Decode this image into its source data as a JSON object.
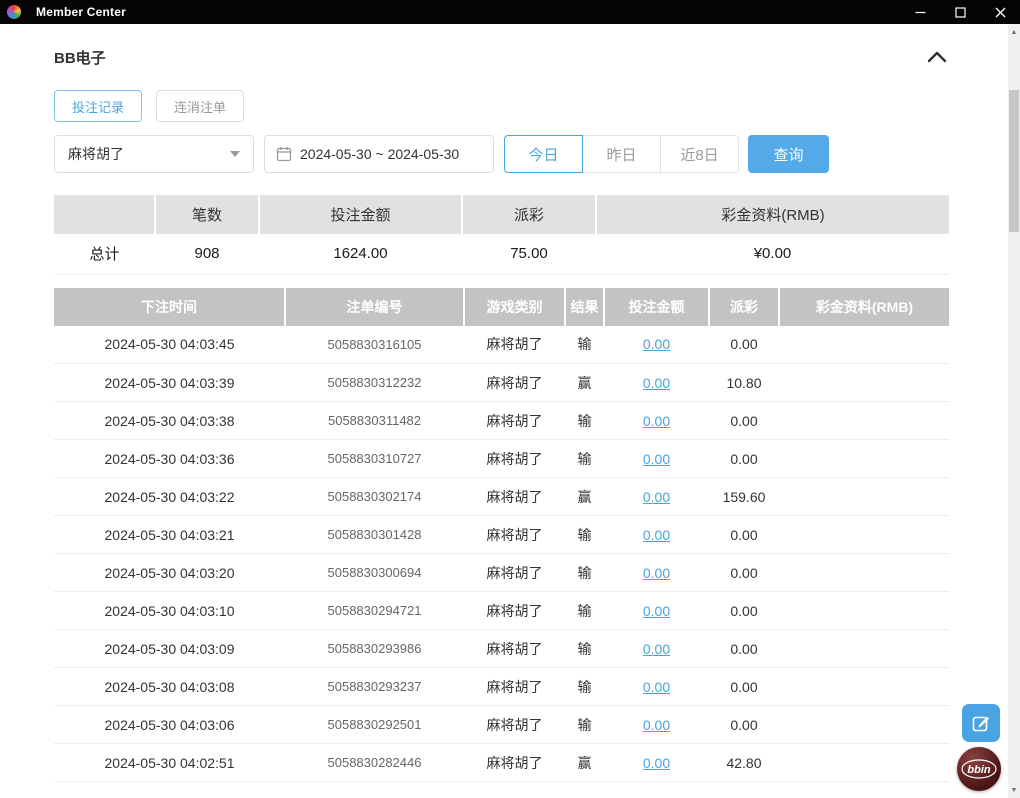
{
  "window": {
    "title": "Member Center"
  },
  "section": {
    "title": "BB电子"
  },
  "tabs": [
    {
      "label": "投注记录",
      "active": true
    },
    {
      "label": "连消注单",
      "active": false
    }
  ],
  "filters": {
    "game_select": {
      "value": "麻将胡了"
    },
    "date_range": {
      "value": "2024-05-30 ~ 2024-05-30"
    },
    "quick": [
      {
        "label": "今日",
        "active": true
      },
      {
        "label": "昨日",
        "active": false
      },
      {
        "label": "近8日",
        "active": false
      }
    ],
    "search_label": "查询"
  },
  "summary": {
    "headers": [
      "",
      "笔数",
      "投注金额",
      "派彩",
      "彩金资料(RMB)"
    ],
    "row": {
      "label": "总计",
      "count": "908",
      "bet_amount": "1624.00",
      "payout": "75.00",
      "bonus": "¥0.00"
    }
  },
  "table": {
    "headers": [
      "下注时间",
      "注单编号",
      "游戏类别",
      "结果",
      "投注金额",
      "派彩",
      "彩金资料(RMB)"
    ],
    "rows": [
      [
        "2024-05-30 04:03:45",
        "5058830316105",
        "麻将胡了",
        "输",
        "0.00",
        "0.00",
        ""
      ],
      [
        "2024-05-30 04:03:39",
        "5058830312232",
        "麻将胡了",
        "赢",
        "0.00",
        "10.80",
        ""
      ],
      [
        "2024-05-30 04:03:38",
        "5058830311482",
        "麻将胡了",
        "输",
        "0.00",
        "0.00",
        ""
      ],
      [
        "2024-05-30 04:03:36",
        "5058830310727",
        "麻将胡了",
        "输",
        "0.00",
        "0.00",
        ""
      ],
      [
        "2024-05-30 04:03:22",
        "5058830302174",
        "麻将胡了",
        "赢",
        "0.00",
        "159.60",
        ""
      ],
      [
        "2024-05-30 04:03:21",
        "5058830301428",
        "麻将胡了",
        "输",
        "0.00",
        "0.00",
        ""
      ],
      [
        "2024-05-30 04:03:20",
        "5058830300694",
        "麻将胡了",
        "输",
        "0.00",
        "0.00",
        ""
      ],
      [
        "2024-05-30 04:03:10",
        "5058830294721",
        "麻将胡了",
        "输",
        "0.00",
        "0.00",
        ""
      ],
      [
        "2024-05-30 04:03:09",
        "5058830293986",
        "麻将胡了",
        "输",
        "0.00",
        "0.00",
        ""
      ],
      [
        "2024-05-30 04:03:08",
        "5058830293237",
        "麻将胡了",
        "输",
        "0.00",
        "0.00",
        ""
      ],
      [
        "2024-05-30 04:03:06",
        "5058830292501",
        "麻将胡了",
        "输",
        "0.00",
        "0.00",
        ""
      ],
      [
        "2024-05-30 04:02:51",
        "5058830282446",
        "麻将胡了",
        "赢",
        "0.00",
        "42.80",
        ""
      ]
    ]
  },
  "icons": {
    "scroll_up": "▲",
    "scroll_down": "▼"
  },
  "floating": {
    "bbin_label": "bbin"
  },
  "colors": {
    "accent_blue": "#54a9e8",
    "link_blue": "#4aa3dc",
    "table_header_gray": "#c3c3c3",
    "summary_header_gray": "#e1e1e1",
    "titlebar_black": "#040404"
  }
}
